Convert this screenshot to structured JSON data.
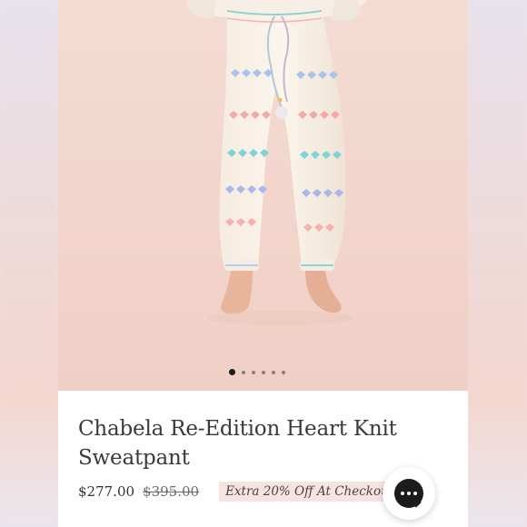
{
  "product": {
    "title": "Chabela Re-Edition Heart Knit Sweatpant",
    "price_current": "$277.00",
    "price_original": "$395.00",
    "promo": "Extra 20% Off At Checkout"
  },
  "carousel": {
    "count": 6,
    "active_index": 0
  },
  "icons": {
    "chat": "chat-bubble-icon"
  },
  "colors": {
    "background": "#f3ddd5",
    "text": "#3a3a3a",
    "promo_bg": "#f7e4e0",
    "chat_button": "#1c1c1c",
    "heart_blue": "#9fc3ea",
    "heart_pink": "#f3a9a8",
    "heart_teal": "#7fd3d6"
  }
}
